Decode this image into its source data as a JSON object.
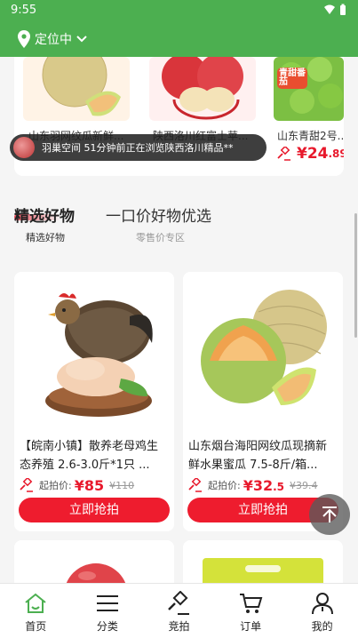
{
  "status_bar": {
    "time": "9:55"
  },
  "header": {
    "location_label": "定位中"
  },
  "top_strip": {
    "items": [
      {
        "name": "山东羽网纹瓜新鲜..."
      },
      {
        "name": "陕西洛川红富士苹..."
      },
      {
        "name": "山东青甜2号...",
        "price_main": "¥24",
        "price_dec": ".89",
        "image_label": "青甜番茄"
      }
    ]
  },
  "toast": {
    "message": "羽巢空间 51分钟前正在浏览陕西洛川精品**"
  },
  "tabs": [
    {
      "label": "精选好物",
      "sub": "精选好物"
    },
    {
      "label": "一口价好物优选",
      "sub": "零售价专区"
    }
  ],
  "products": [
    {
      "title": "【皖南小镇】散养老母鸡生态养殖 2.6-3.0斤*1只 ...",
      "start_label": "起拍价:",
      "price_main": "¥85",
      "price_dec": "",
      "original_price": "¥110",
      "button": "立即抢拍"
    },
    {
      "title": "山东烟台海阳网纹瓜现摘新鲜水果蜜瓜 7.5-8斤/箱...",
      "start_label": "起拍价:",
      "price_main": "¥32",
      "price_dec": ".5",
      "original_price": "¥39.4",
      "button": "立即抢拍"
    }
  ],
  "bottom_nav": [
    {
      "label": "首页",
      "icon": "home-icon",
      "active": true
    },
    {
      "label": "分类",
      "icon": "menu-icon"
    },
    {
      "label": "竞拍",
      "icon": "auction-hammer-icon"
    },
    {
      "label": "订单",
      "icon": "cart-icon"
    },
    {
      "label": "我的",
      "icon": "user-icon"
    }
  ],
  "colors": {
    "primary_green": "#4caf50",
    "price_red": "#e8192c",
    "button_red": "#ee1c2e"
  }
}
